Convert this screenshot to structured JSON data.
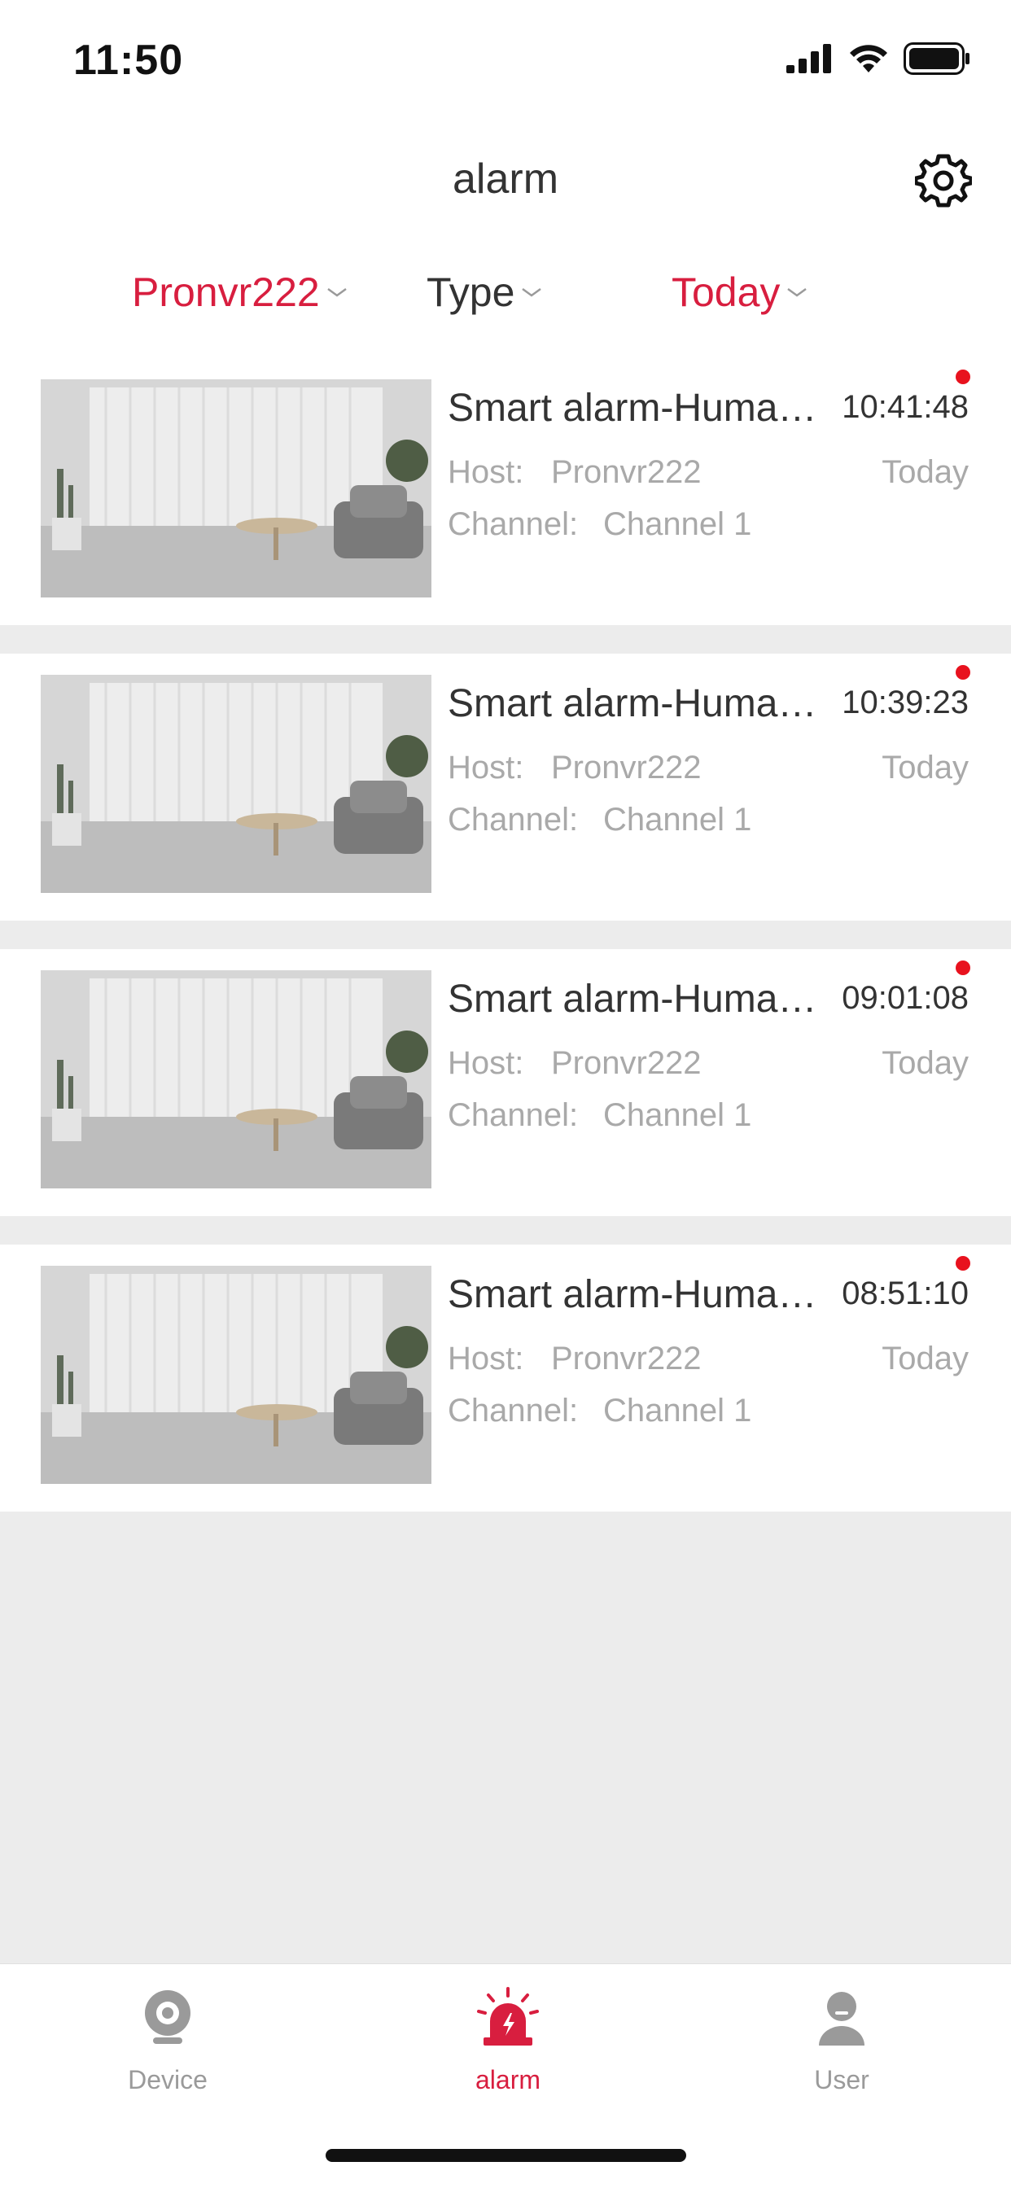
{
  "status_bar": {
    "time": "11:50"
  },
  "header": {
    "title": "alarm"
  },
  "filters": {
    "host": "Pronvr222",
    "type": "Type",
    "date": "Today"
  },
  "alarms": [
    {
      "title": "Smart alarm-Human detection",
      "time": "10:41:48",
      "host_label": "Host:",
      "host": "Pronvr222",
      "date": "Today",
      "channel_label": "Channel:",
      "channel": "Channel 1"
    },
    {
      "title": "Smart alarm-Human detection",
      "time": "10:39:23",
      "host_label": "Host:",
      "host": "Pronvr222",
      "date": "Today",
      "channel_label": "Channel:",
      "channel": "Channel 1"
    },
    {
      "title": "Smart alarm-Human detection",
      "time": "09:01:08",
      "host_label": "Host:",
      "host": "Pronvr222",
      "date": "Today",
      "channel_label": "Channel:",
      "channel": "Channel 1"
    },
    {
      "title": "Smart alarm-Human detection",
      "time": "08:51:10",
      "host_label": "Host:",
      "host": "Pronvr222",
      "date": "Today",
      "channel_label": "Channel:",
      "channel": "Channel 1"
    }
  ],
  "tabbar": {
    "device": "Device",
    "alarm": "alarm",
    "user": "User"
  },
  "colors": {
    "accent": "#d81e3f",
    "unread": "#e8121e",
    "muted": "#a9a9a9",
    "background": "#ececec"
  },
  "icons": [
    "signal-icon",
    "wifi-icon",
    "battery-icon",
    "settings-icon",
    "chevron-down-icon",
    "camera-icon",
    "siren-icon",
    "user-icon"
  ]
}
